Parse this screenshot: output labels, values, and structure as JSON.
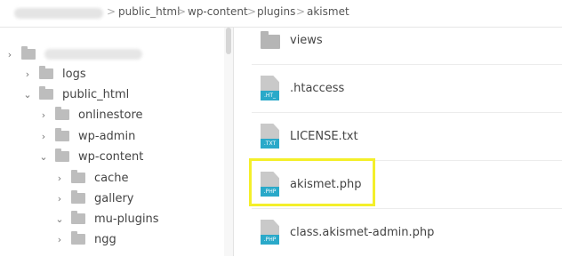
{
  "breadcrumb": {
    "items": [
      "public_html",
      "wp-content",
      "plugins",
      "akismet"
    ],
    "separator": ">"
  },
  "sidebar": {
    "items": [
      {
        "label": "",
        "blurred": true,
        "expanded": false
      },
      {
        "label": "logs",
        "expanded": false
      },
      {
        "label": "public_html",
        "expanded": true
      },
      {
        "label": "onlinestore",
        "expanded": false
      },
      {
        "label": "wp-admin",
        "expanded": false
      },
      {
        "label": "wp-content",
        "expanded": true
      },
      {
        "label": "cache",
        "expanded": false
      },
      {
        "label": "gallery",
        "expanded": false
      },
      {
        "label": "mu-plugins",
        "expanded": true
      },
      {
        "label": "ngg",
        "expanded": false
      }
    ]
  },
  "files": [
    {
      "name": "views",
      "type": "folder"
    },
    {
      "name": ".htaccess",
      "type": "file",
      "tag": ".HT_"
    },
    {
      "name": "LICENSE.txt",
      "type": "file",
      "tag": ".TXT"
    },
    {
      "name": "akismet.php",
      "type": "file",
      "tag": ".PHP",
      "highlighted": true
    },
    {
      "name": "class.akismet-admin.php",
      "type": "file",
      "tag": ".PHP"
    }
  ],
  "colors": {
    "highlight": "#f4ef2a",
    "file_tag": "#2aa9c9",
    "folder": "#bdbdbd"
  },
  "icons": {
    "expanded": "chevron-down-icon",
    "collapsed": "chevron-right-icon",
    "folder": "folder-icon",
    "file": "file-icon"
  }
}
